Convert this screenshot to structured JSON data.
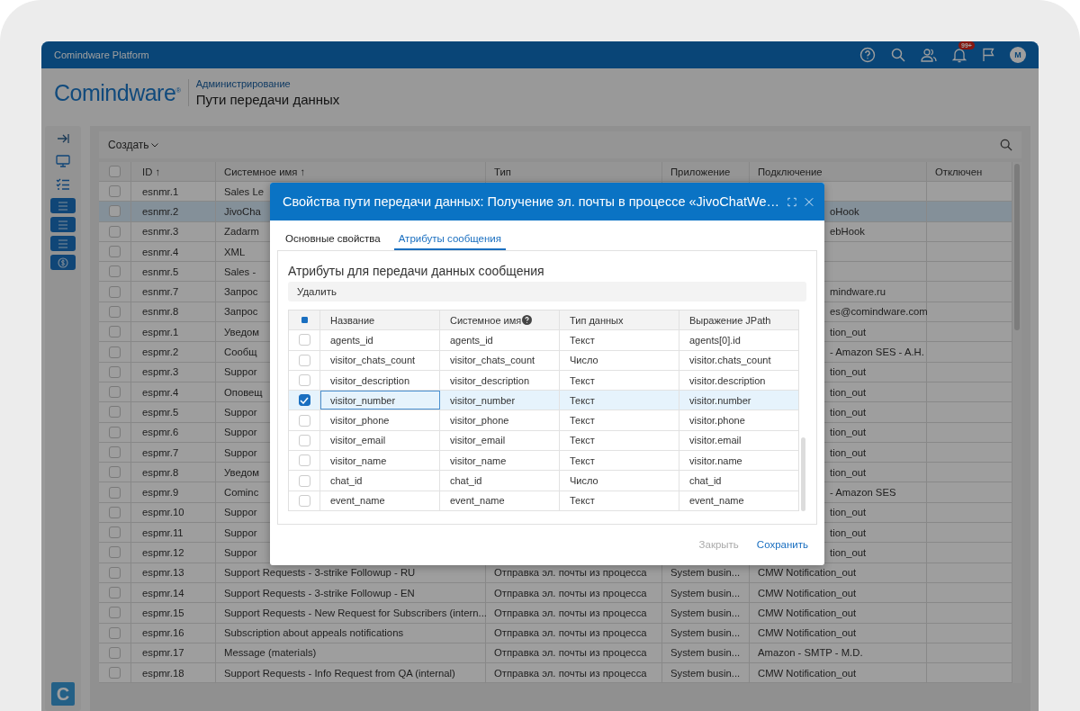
{
  "app_bar": {
    "title": "Comindware Platform",
    "notifications_badge": "99+",
    "avatar": "M"
  },
  "header": {
    "logo": "Comindware$^{®}$",
    "breadcrumb": "Администрирование",
    "title": "Пути передачи данных"
  },
  "sidebar": {
    "logo": "C"
  },
  "toolbar": {
    "create": "Создать"
  },
  "table": {
    "all_checked": false,
    "columns": [
      "ID ↑",
      "Системное имя ↑",
      "Тип",
      "Приложение",
      "Подключение",
      "Отключен"
    ],
    "rows": [
      {
        "id": "esnmr.1",
        "name": "Sales Le",
        "selected": false,
        "checked": false
      },
      {
        "id": "esnmr.2",
        "name": "JivoCha",
        "connection_tail": "oHook",
        "selected": true,
        "checked": false
      },
      {
        "id": "esnmr.3",
        "name": "Zadarm",
        "connection_tail": "ebHook",
        "selected": false,
        "checked": false
      },
      {
        "id": "esnmr.4",
        "name": "XML",
        "selected": false,
        "checked": false
      },
      {
        "id": "esnmr.5",
        "name": "Sales -",
        "selected": false,
        "checked": false
      },
      {
        "id": "esnmr.7",
        "name": "Запрос",
        "connection_tail": "mindware.ru",
        "selected": false,
        "checked": false
      },
      {
        "id": "esnmr.8",
        "name": "Запрос",
        "connection_tail": "es@comindware.com",
        "selected": false,
        "checked": false
      },
      {
        "id": "espmr.1",
        "name": "Уведом",
        "connection_tail": "tion_out",
        "selected": false,
        "checked": false
      },
      {
        "id": "espmr.2",
        "name": "Сообщ",
        "connection_tail": "- Amazon SES - A.H.",
        "selected": false,
        "checked": false
      },
      {
        "id": "espmr.3",
        "name": "Suppor",
        "connection_tail": "tion_out",
        "selected": false,
        "checked": false
      },
      {
        "id": "espmr.4",
        "name": "Оповещ",
        "connection_tail": "tion_out",
        "selected": false,
        "checked": false
      },
      {
        "id": "espmr.5",
        "name": "Suppor",
        "connection_tail": "tion_out",
        "selected": false,
        "checked": false
      },
      {
        "id": "espmr.6",
        "name": "Suppor",
        "connection_tail": "tion_out",
        "selected": false,
        "checked": false
      },
      {
        "id": "espmr.7",
        "name": "Suppor",
        "connection_tail": "tion_out",
        "selected": false,
        "checked": false
      },
      {
        "id": "espmr.8",
        "name": "Уведом",
        "connection_tail": "tion_out",
        "selected": false,
        "checked": false
      },
      {
        "id": "espmr.9",
        "name": "Cominc",
        "connection_tail": "- Amazon SES",
        "selected": false,
        "checked": false
      },
      {
        "id": "espmr.10",
        "name": "Suppor",
        "connection_tail": "tion_out",
        "selected": false,
        "checked": false
      },
      {
        "id": "espmr.11",
        "name": "Suppor",
        "connection_tail": "tion_out",
        "selected": false,
        "checked": false
      },
      {
        "id": "espmr.12",
        "name": "Suppor",
        "connection_tail": "tion_out",
        "selected": false,
        "checked": false
      },
      {
        "id": "espmr.13",
        "name": "Support Requests - 3-strike Followup - RU",
        "type": "Отправка эл. почты из процесса",
        "application": "System busin...",
        "connection": "CMW Notification_out",
        "selected": false,
        "checked": false
      },
      {
        "id": "espmr.14",
        "name": "Support Requests - 3-strike Followup - EN",
        "type": "Отправка эл. почты из процесса",
        "application": "System busin...",
        "connection": "CMW Notification_out",
        "selected": false,
        "checked": false
      },
      {
        "id": "espmr.15",
        "name": "Support Requests - New Request for Subscribers (intern...",
        "type": "Отправка эл. почты из процесса",
        "application": "System busin...",
        "connection": "CMW Notification_out",
        "selected": false,
        "checked": false
      },
      {
        "id": "espmr.16",
        "name": "Subscription about appeals notifications",
        "type": "Отправка эл. почты из процесса",
        "application": "System busin...",
        "connection": "CMW Notification_out",
        "selected": false,
        "checked": false
      },
      {
        "id": "espmr.17",
        "name": "Message (materials)",
        "type": "Отправка эл. почты из процесса",
        "application": "System busin...",
        "connection": "Amazon - SMTP - M.D.",
        "selected": false,
        "checked": false
      },
      {
        "id": "espmr.18",
        "name": "Support Requests - Info Request from QA (internal)",
        "type": "Отправка эл. почты из процесса",
        "application": "System busin...",
        "connection": "CMW Notification_out",
        "selected": false,
        "checked": false
      }
    ]
  },
  "dialog": {
    "title": "Свойства пути передачи данных: Получение эл. почты в процессе «JivoChatWe…",
    "tabs": [
      {
        "label": "Основные свойства",
        "selected": false
      },
      {
        "label": "Атрибуты сообщения",
        "selected": true
      }
    ],
    "heading": "Атрибуты для передачи данных сообщения",
    "delete": "Удалить",
    "select_all": {
      "indeterminate": true
    },
    "columns": [
      "Название",
      "Системное имя",
      "Тип данных",
      "Выражение JPath"
    ],
    "rows": [
      {
        "name": "agents_id",
        "system_name": "agents_id",
        "data_type": "Текст",
        "jpath": "agents[0].id",
        "checked": false,
        "selected": false
      },
      {
        "name": "visitor_chats_count",
        "system_name": "visitor_chats_count",
        "data_type": "Число",
        "jpath": "visitor.chats_count",
        "checked": false,
        "selected": false
      },
      {
        "name": "visitor_description",
        "system_name": "visitor_description",
        "data_type": "Текст",
        "jpath": "visitor.description",
        "checked": false,
        "selected": false
      },
      {
        "name": "visitor_number",
        "system_name": "visitor_number",
        "data_type": "Текст",
        "jpath": "visitor.number",
        "checked": true,
        "selected": true
      },
      {
        "name": "visitor_phone",
        "system_name": "visitor_phone",
        "data_type": "Текст",
        "jpath": "visitor.phone",
        "checked": false,
        "selected": false
      },
      {
        "name": "visitor_email",
        "system_name": "visitor_email",
        "data_type": "Текст",
        "jpath": "visitor.email",
        "checked": false,
        "selected": false
      },
      {
        "name": "visitor_name",
        "system_name": "visitor_name",
        "data_type": "Текст",
        "jpath": "visitor.name",
        "checked": false,
        "selected": false
      },
      {
        "name": "chat_id",
        "system_name": "chat_id",
        "data_type": "Число",
        "jpath": "chat_id",
        "checked": false,
        "selected": false
      },
      {
        "name": "event_name",
        "system_name": "event_name",
        "data_type": "Текст",
        "jpath": "event_name",
        "checked": false,
        "selected": false
      }
    ],
    "buttons": [
      {
        "label": "Закрыть",
        "disabled": true
      },
      {
        "label": "Сохранить",
        "disabled": false
      }
    ]
  }
}
